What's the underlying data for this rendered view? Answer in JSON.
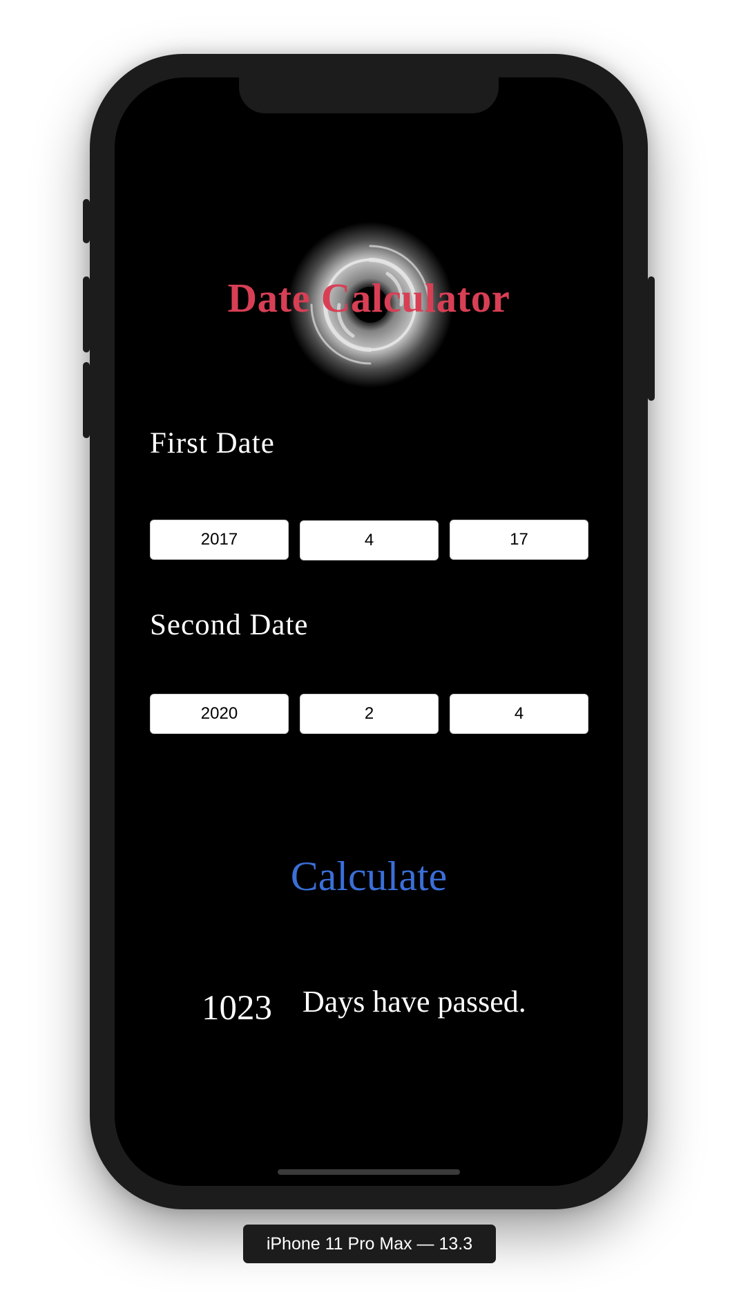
{
  "app": {
    "title": "Date Calculator"
  },
  "first_date": {
    "label": "First Date",
    "year": "2017",
    "month": "4",
    "day": "17"
  },
  "second_date": {
    "label": "Second Date",
    "year": "2020",
    "month": "2",
    "day": "4"
  },
  "calculate_button": {
    "label": "Calculate"
  },
  "result": {
    "days": "1023",
    "text": "Days have passed."
  },
  "simulator": {
    "device_label": "iPhone 11 Pro Max — 13.3"
  },
  "colors": {
    "title": "#d83f55",
    "button": "#3a6fd8",
    "background": "#000000",
    "device_frame": "#1c1c1c"
  }
}
